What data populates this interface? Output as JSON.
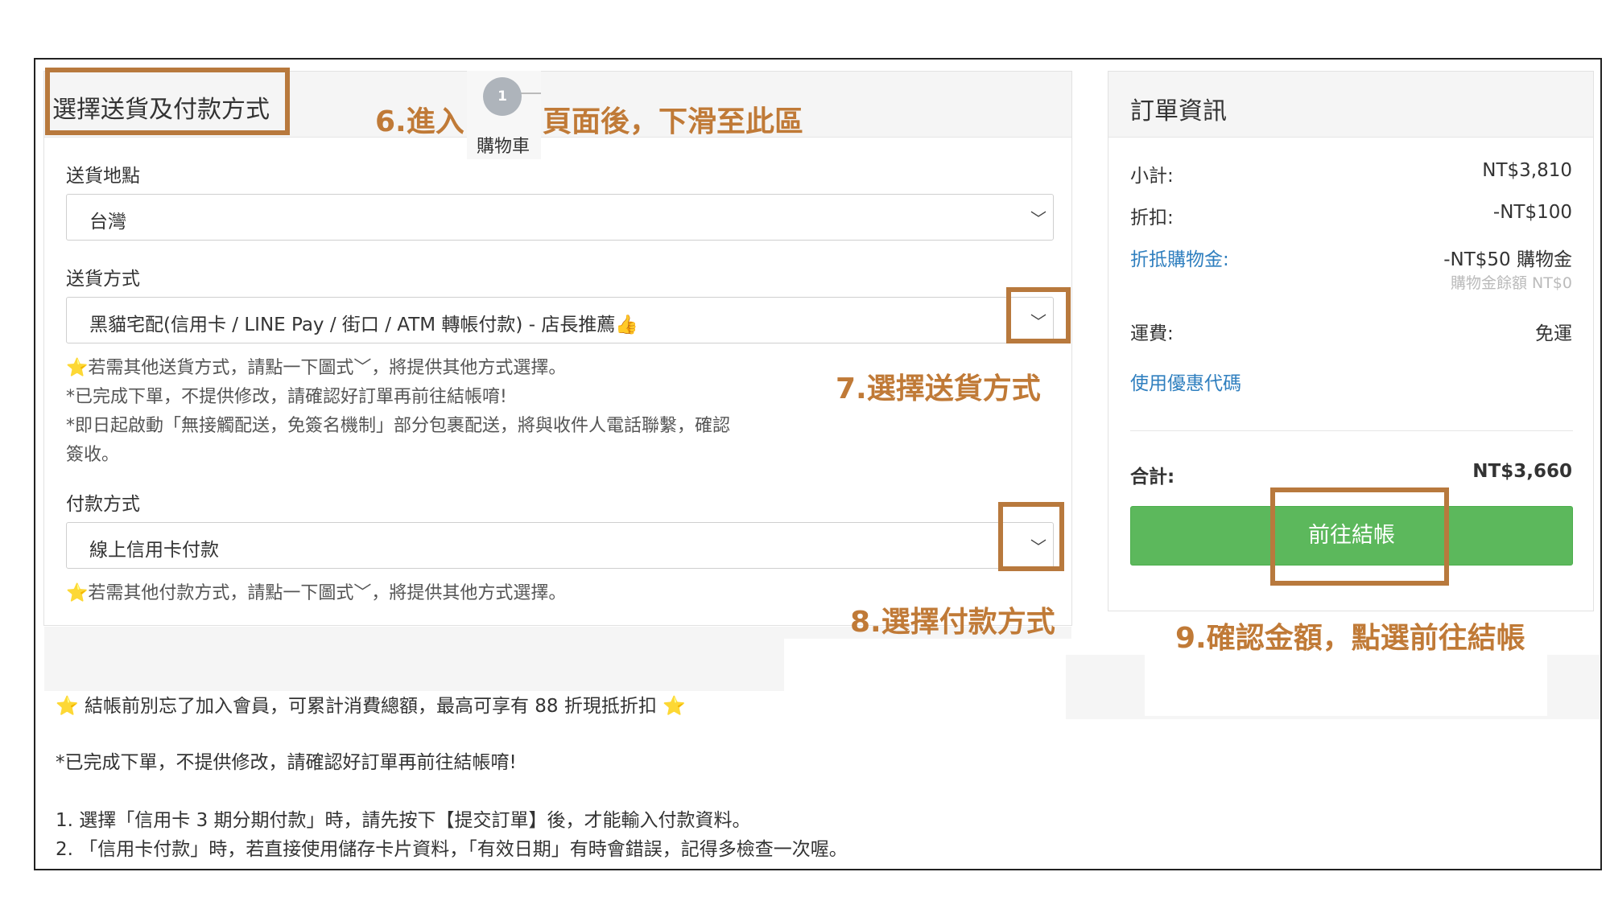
{
  "shipping_section": {
    "title": "選擇送貨及付款方式",
    "location_label": "送貨地點",
    "location_value": "台灣",
    "method_label": "送貨方式",
    "method_value": "黑貓宅配(信用卡 / LINE Pay / 街口 / ATM 轉帳付款) - 店長推薦👍",
    "method_notes": [
      "⭐若需其他送貨方式，請點一下圖式﹀，將提供其他方式選擇。",
      "*已完成下單，不提供修改，請確認好訂單再前往結帳唷!",
      "*即日起啟動「無接觸配送，免簽名機制」部分包裹配送，將與收件人電話聯繫，確認",
      "簽收。"
    ],
    "payment_label": "付款方式",
    "payment_value": "線上信用卡付款",
    "payment_note": "⭐若需其他付款方式，請點一下圖式﹀，將提供其他方式選擇。",
    "dropdown_arrow": "﹀"
  },
  "step_indicator": {
    "number": "1",
    "label": "購物車"
  },
  "order_summary": {
    "title": "訂單資訊",
    "subtotal_label": "小計:",
    "subtotal_value": "NT$3,810",
    "discount_label": "折扣:",
    "discount_value": "-NT$100",
    "credit_label": "折抵購物金:",
    "credit_value": "-NT$50 購物金",
    "credit_balance": "購物金餘額 NT$0",
    "shipping_label": "運費:",
    "shipping_value": "免運",
    "coupon_link": "使用優惠代碼",
    "total_label": "合計:",
    "total_value": "NT$3,660",
    "checkout_button": "前往結帳"
  },
  "bottom_notes": {
    "member_note": "⭐ 結帳前別忘了加入會員，可累計消費總額，最高可享有 88 折現抵折扣 ⭐",
    "confirm_note": "*已完成下單，不提供修改，請確認好訂單再前往結帳唷!",
    "items": [
      "1. 選擇「信用卡 3 期分期付款」時，請先按下【提交訂單】後，才能輸入付款資料。",
      "2. 「信用卡付款」時，若直接使用儲存卡片資料，「有效日期」有時會錯誤，記得多檢查一次喔。"
    ]
  },
  "annotations": {
    "step6_prefix": "6.進入",
    "step6_suffix": "頁面後，下滑至此區",
    "step7": "7.選擇送貨方式",
    "step8": "8.選擇付款方式",
    "step9": "9.確認金額，點選前往結帳",
    "color": "#c07a37"
  },
  "colors": {
    "checkout_green": "#5cb85c",
    "link_blue": "#2f7fbf",
    "highlight_border": "#b8793d"
  }
}
